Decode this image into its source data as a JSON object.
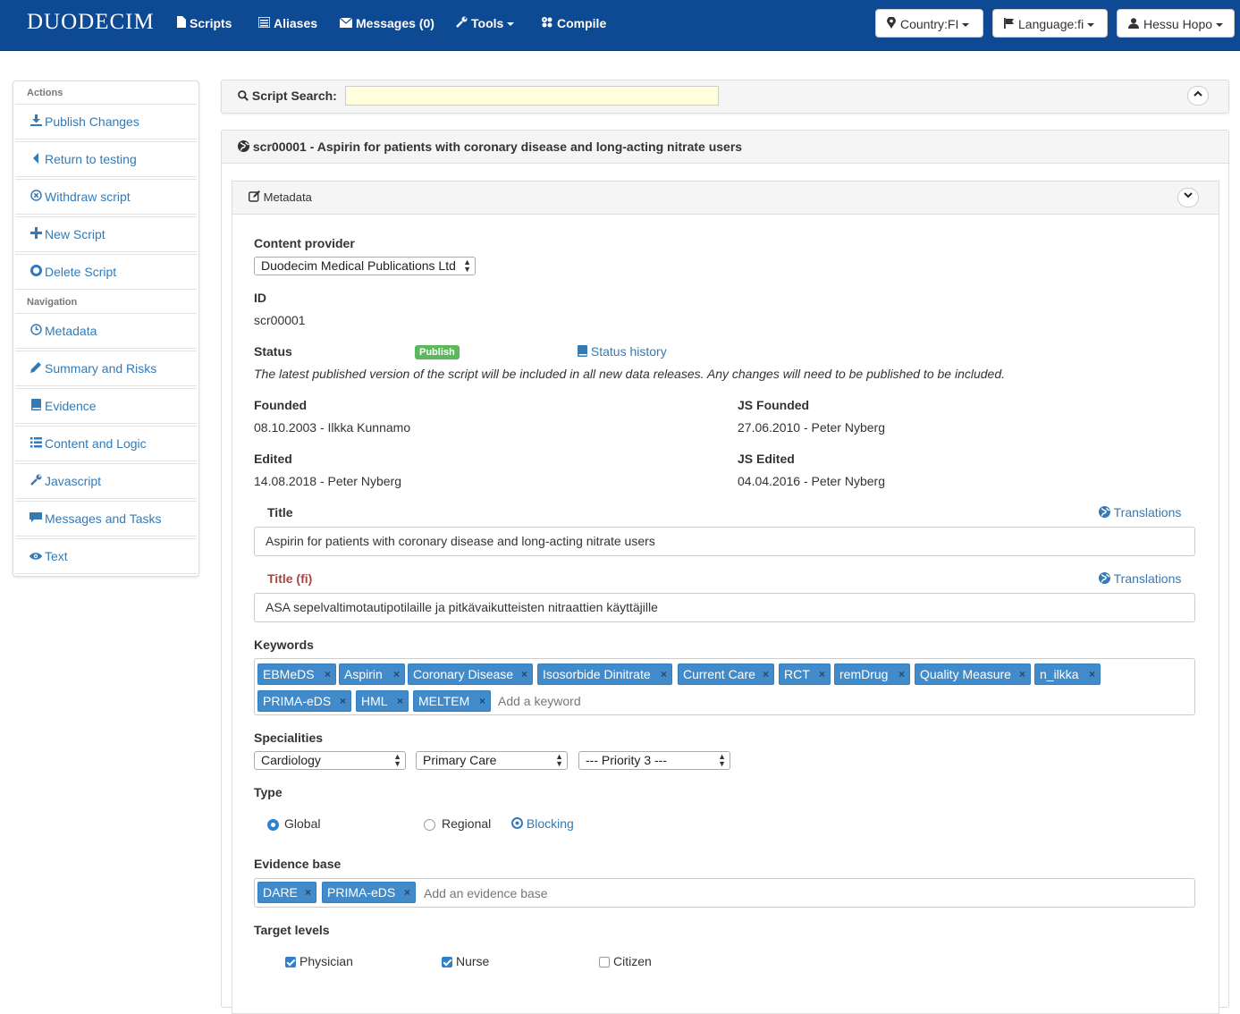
{
  "navbar": {
    "brand": "DUODECIM",
    "items": [
      {
        "label": "Scripts",
        "icon": "file-icon"
      },
      {
        "label": "Aliases",
        "icon": "list-icon"
      },
      {
        "label": "Messages (0)",
        "icon": "envelope-icon"
      },
      {
        "label": "Tools",
        "icon": "wrench-icon"
      },
      {
        "label": "Compile",
        "icon": "cogs-icon"
      }
    ],
    "country": "Country:FI",
    "language": "Language:fi",
    "user": "Hessu Hopo"
  },
  "sidebar": {
    "actions_header": "Actions",
    "actions": [
      {
        "label": "Publish Changes",
        "icon": "download-icon"
      },
      {
        "label": "Return to testing",
        "icon": "caret-left-icon"
      },
      {
        "label": "Withdraw script",
        "icon": "remove-circle-icon"
      },
      {
        "label": "New Script",
        "icon": "plus-icon"
      },
      {
        "label": "Delete Script",
        "icon": "minus-circle-icon"
      }
    ],
    "navigation_header": "Navigation",
    "navigation": [
      {
        "label": "Metadata",
        "icon": "clock-icon"
      },
      {
        "label": "Summary and Risks",
        "icon": "pencil-icon"
      },
      {
        "label": "Evidence",
        "icon": "book-icon"
      },
      {
        "label": "Content and Logic",
        "icon": "list-icon"
      },
      {
        "label": "Javascript",
        "icon": "wrench-icon"
      },
      {
        "label": "Messages and Tasks",
        "icon": "comment-icon"
      },
      {
        "label": "Text",
        "icon": "eye-icon"
      }
    ]
  },
  "search": {
    "label": "Script Search:",
    "value": ""
  },
  "script": {
    "title": "scr00001 - Aspirin for patients with coronary disease and long-acting nitrate users"
  },
  "metadata": {
    "header": "Metadata",
    "content_provider_label": "Content provider",
    "content_provider": "Duodecim Medical Publications Ltd",
    "id_label": "ID",
    "id": "scr00001",
    "status_label": "Status",
    "status_badge": "Publish",
    "status_history": "Status history",
    "status_note": "The latest published version of the script will be included in all new data releases. Any changes will need to be published to be included.",
    "founded_label": "Founded",
    "founded": "08.10.2003 - Ilkka Kunnamo",
    "js_founded_label": "JS Founded",
    "js_founded": "27.06.2010 - Peter Nyberg",
    "edited_label": "Edited",
    "edited": "14.08.2018 - Peter Nyberg",
    "js_edited_label": "JS Edited",
    "js_edited": "04.04.2016 - Peter Nyberg",
    "title_label": "Title",
    "title_value": "Aspirin for patients with coronary disease and long-acting nitrate users",
    "translations_label": "Translations",
    "title_fi_label": "Title (fi)",
    "title_fi_value": "ASA sepelvaltimotautipotilaille ja pitkävaikutteisten nitraattien käyttäjille",
    "keywords_label": "Keywords",
    "keywords": [
      "EBMeDS",
      "Aspirin",
      "Coronary Disease",
      "Isosorbide Dinitrate",
      "Current Care",
      "RCT",
      "remDrug",
      "Quality Measure",
      "n_ilkka",
      "PRIMA-eDS",
      "HML",
      "MELTEM"
    ],
    "keyword_placeholder": "Add a keyword",
    "specialities_label": "Specialities",
    "speciality_1": "Cardiology",
    "speciality_2": "Primary Care",
    "priority": "--- Priority 3 ---",
    "type_label": "Type",
    "type_global": "Global",
    "type_regional": "Regional",
    "type_blocking": "Blocking",
    "evidence_label": "Evidence base",
    "evidence": [
      "DARE",
      "PRIMA-eDS"
    ],
    "evidence_placeholder": "Add an evidence base",
    "target_label": "Target levels",
    "target_physician": "Physician",
    "target_nurse": "Nurse",
    "target_citizen": "Citizen"
  },
  "colors": {
    "navbar": "#0e4a94",
    "link": "#337ab7",
    "tag": "#428bca",
    "badge": "#5cb85c",
    "title_fi_label": "#a94442"
  }
}
